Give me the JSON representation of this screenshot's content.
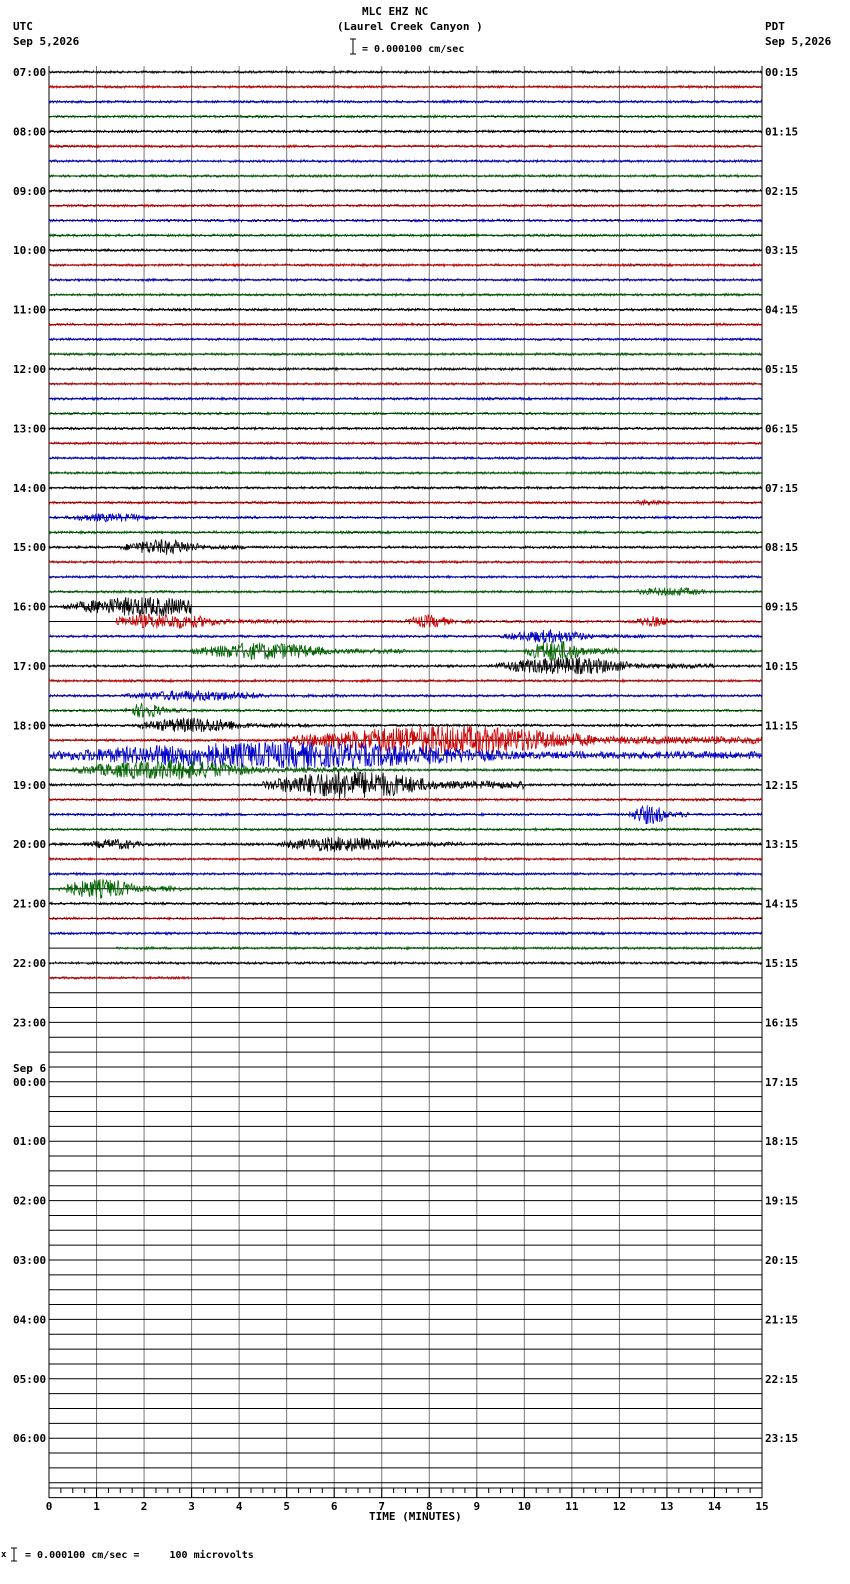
{
  "header": {
    "title": "MLC EHZ NC",
    "subtitle": "(Laurel Creek Canyon )",
    "scale_text": "= 0.000100 cm/sec",
    "left_tz": "UTC",
    "left_date": "Sep 5,2026",
    "right_tz": "PDT",
    "right_date": "Sep 5,2026"
  },
  "footer": {
    "scale_text": "= 0.000100 cm/sec =     100 microvolts"
  },
  "colors": {
    "traces": [
      "#000000",
      "#cc0000",
      "#0000cc",
      "#006600"
    ],
    "grid": "#000000"
  },
  "chart_data": {
    "type": "line",
    "description_free": true,
    "xlabel": "TIME (MINUTES)",
    "xlim": [
      0,
      15
    ],
    "x_ticks": [
      "0",
      "1",
      "2",
      "3",
      "4",
      "5",
      "6",
      "7",
      "8",
      "9",
      "10",
      "11",
      "12",
      "13",
      "14",
      "15"
    ],
    "rows_per_hour": 4,
    "hours": [
      {
        "utc": "07:00",
        "pdt": "00:15"
      },
      {
        "utc": "08:00",
        "pdt": "01:15"
      },
      {
        "utc": "09:00",
        "pdt": "02:15"
      },
      {
        "utc": "10:00",
        "pdt": "03:15"
      },
      {
        "utc": "11:00",
        "pdt": "04:15"
      },
      {
        "utc": "12:00",
        "pdt": "05:15"
      },
      {
        "utc": "13:00",
        "pdt": "06:15"
      },
      {
        "utc": "14:00",
        "pdt": "07:15"
      },
      {
        "utc": "15:00",
        "pdt": "08:15"
      },
      {
        "utc": "16:00",
        "pdt": "09:15"
      },
      {
        "utc": "17:00",
        "pdt": "10:15"
      },
      {
        "utc": "18:00",
        "pdt": "11:15"
      },
      {
        "utc": "19:00",
        "pdt": "12:15"
      },
      {
        "utc": "20:00",
        "pdt": "13:15"
      },
      {
        "utc": "21:00",
        "pdt": "14:15"
      },
      {
        "utc": "22:00",
        "pdt": "15:15"
      },
      {
        "utc": "23:00",
        "pdt": "16:15"
      },
      {
        "utc": "00:00",
        "utc_date": "Sep 6",
        "pdt": "17:15"
      },
      {
        "utc": "01:00",
        "pdt": "18:15"
      },
      {
        "utc": "02:00",
        "pdt": "19:15"
      },
      {
        "utc": "03:00",
        "pdt": "20:15"
      },
      {
        "utc": "04:00",
        "pdt": "21:15"
      },
      {
        "utc": "05:00",
        "pdt": "22:15"
      },
      {
        "utc": "06:00",
        "pdt": "23:15"
      }
    ],
    "recorded_rows": 62,
    "row_end_minutes": {
      "36": 3,
      "61": 3
    },
    "row_start_minutes": {
      "37": 1.4,
      "59": 1.4
    },
    "bursts": [
      {
        "row": 29,
        "start": 12.2,
        "end": 13.5,
        "amp": 3
      },
      {
        "row": 30,
        "start": 0.3,
        "end": 3.3,
        "amp": 4
      },
      {
        "row": 32,
        "start": 1.5,
        "end": 4.2,
        "amp": 7
      },
      {
        "row": 35,
        "start": 12.2,
        "end": 14.8,
        "amp": 4
      },
      {
        "row": 36,
        "start": 0.3,
        "end": 5.5,
        "amp": 9
      },
      {
        "row": 37,
        "start": 1.0,
        "end": 5.2,
        "amp": 7
      },
      {
        "row": 37,
        "start": 7.5,
        "end": 9.0,
        "amp": 6
      },
      {
        "row": 37,
        "start": 12.3,
        "end": 13.5,
        "amp": 5
      },
      {
        "row": 38,
        "start": 9.5,
        "end": 12.5,
        "amp": 6
      },
      {
        "row": 39,
        "start": 3.0,
        "end": 7.5,
        "amp": 8
      },
      {
        "row": 39,
        "start": 10.0,
        "end": 12.0,
        "amp": 10
      },
      {
        "row": 40,
        "start": 9.3,
        "end": 14.0,
        "amp": 8
      },
      {
        "row": 42,
        "start": 1.5,
        "end": 6.3,
        "amp": 5
      },
      {
        "row": 43,
        "start": 1.6,
        "end": 2.9,
        "amp": 7
      },
      {
        "row": 44,
        "start": 1.8,
        "end": 5.5,
        "amp": 7
      },
      {
        "row": 45,
        "start": 5.0,
        "end": 15.0,
        "amp": 13
      },
      {
        "row": 46,
        "start": 0.0,
        "end": 15.0,
        "amp": 12
      },
      {
        "row": 47,
        "start": 0.5,
        "end": 6.5,
        "amp": 9
      },
      {
        "row": 48,
        "start": 4.5,
        "end": 10.0,
        "amp": 13
      },
      {
        "row": 50,
        "start": 12.2,
        "end": 13.5,
        "amp": 9
      },
      {
        "row": 52,
        "start": 0.8,
        "end": 2.6,
        "amp": 5
      },
      {
        "row": 52,
        "start": 4.8,
        "end": 8.7,
        "amp": 7
      },
      {
        "row": 55,
        "start": 0.2,
        "end": 2.8,
        "amp": 9
      }
    ]
  }
}
